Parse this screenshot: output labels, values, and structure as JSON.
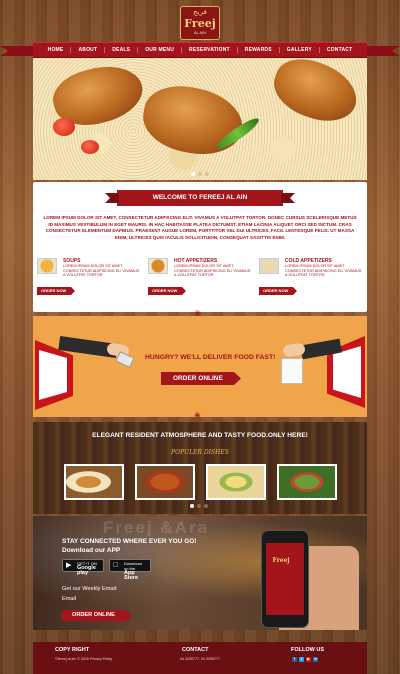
{
  "logo": {
    "arabic": "فريج",
    "name": "Freej",
    "sub": "AL AIN"
  },
  "nav": [
    "HOME",
    "ABOUT",
    "DEALS",
    "OUR MENU",
    "RESERVATIONT",
    "REWARDS",
    "GALLERY",
    "CONTACT"
  ],
  "welcome": {
    "title": "WELCOME TO FEREEJ AL AIN",
    "text": "LOREM IPSUM DOLOR SIT AMET, CONSECTETUR ADIPISCING ELIT. VIVAMUS A VOLUTPAT TORTOR. DONEC CURSUS SCELERISQUE METUS ID MAXIMUS VESTIBULUM IN EGET MAURIS. IN HAC HABITASSE PLATEA DICTUMST. ETIAM LACINIA ALIQUET ORCI SED DICTUM. CRAS CONSECTETUR ELEMENTUM DAPIBUS. PRAESENT AUGUE LOREM, PORTTITOR VEL DUI ULTRICES, FACIL LENTESQUE FELIS. UT MASSA ENIM, ULTRICES QUIS IACULIS SOLLICITUDIN, CONSEQUAT SAGITTIS ENIM.",
    "categories": [
      {
        "name": "SOUPS",
        "desc": "LOREM IPSUM DOLOR SIT AMET CONSECTETUR ADIPISCING ELI VIVAMUS A VOLUTPAT TORTOR",
        "button": "ORDER NOW"
      },
      {
        "name": "HOT APPETIZERS",
        "desc": "LOREM IPSUM DOLOR SIT AMET CONSECTETUR ADIPISCING ELI VIVAMUS A VOLUTPAT TORTOR",
        "button": "ORDER NOW"
      },
      {
        "name": "COLD APPETIZERS",
        "desc": "LOREM IPSUM DOLOR SIT AMET CONSECTETUR ADIPISCING ELI VIVAMUS A VOLUTPAT TORTOR",
        "button": "ORDER NOW"
      }
    ]
  },
  "delivery": {
    "headline": "HUNGRY? WE'LL DELIVER FOOD FAST!",
    "button": "ORDER ONLINE"
  },
  "popular": {
    "title": "ELEGANT RESIDENT ATMOSPHERE AND TASTY FOOD.ONLY HERE!",
    "subtitle": "POPULER DISHES"
  },
  "app": {
    "brand_bg": "Freej  &Ara",
    "stay": "STAY CONNECTED WHERE EVER YOU GO!",
    "download": "Download our APP",
    "google_small": "GET IT ON",
    "google_big": "Google play",
    "apple_small": "Download on the",
    "apple_big": "App Store",
    "weekly": "Get our Weekly Email:",
    "email_label": "Email",
    "button": "ORDER ONLINE",
    "phone_logo": "Freej"
  },
  "footer": {
    "copy_title": "COPY RIGHT",
    "copy_text": "©fereej al ain © 2016 Privacy Policy",
    "contact_title": "CONTACT",
    "contact_text": "04 3255777, 04 3255777",
    "follow_title": "FOLLOW US"
  },
  "colors": {
    "brand_red": "#a3141b",
    "accent_orange": "#f0a54a",
    "footer": "#6a0f12"
  }
}
